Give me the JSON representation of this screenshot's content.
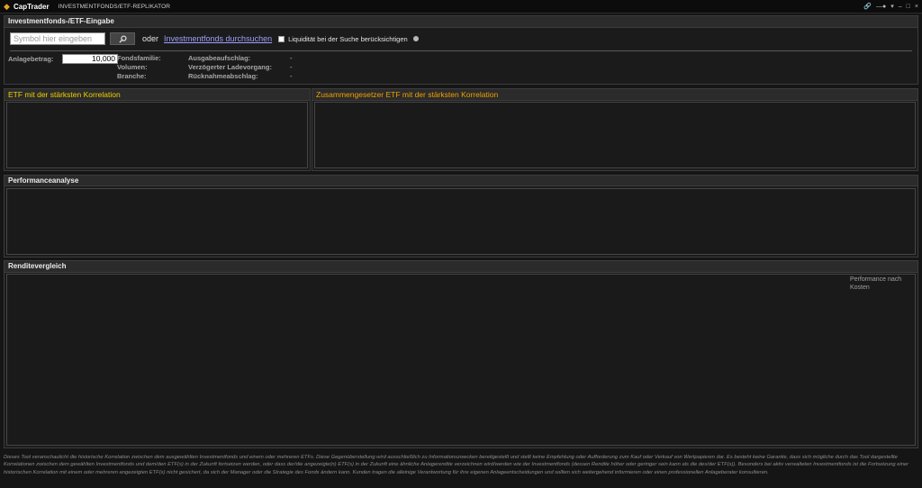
{
  "window": {
    "brand": "CapTrader",
    "title": "INVESTMENTFONDS/ETF-REPLIKATOR",
    "controls": [
      "link-icon",
      "pin-icon",
      "minimize-icon",
      "maximize-icon",
      "close-icon"
    ]
  },
  "input_section": {
    "title": "Investmentfonds-/ETF-Eingabe",
    "symbol_placeholder": "Symbol hier eingeben",
    "or_text": "oder",
    "search_link": "Investmentfonds durchsuchen",
    "liquidity_label": "Liquidität bei der Suche berücksichtigen",
    "liquidity_checked": false,
    "amount_label": "Anlagebetrag:",
    "amount_value": "10,000",
    "fund_family_label": "Fondsfamilie:",
    "volume_label": "Volumen:",
    "sector_label": "Branche:",
    "load_label": "Ausgabeaufschlag:",
    "load_value": "-",
    "delayed_label": "Verzögerter Ladevorgang:",
    "delayed_value": "-",
    "redemption_label": "Rücknahmeabschlag:",
    "redemption_value": "-"
  },
  "correlation": {
    "left_title": "ETF mit der stärksten Korrelation",
    "right_title": "Zusammengesetzer ETF mit der stärksten Korrelation",
    "left_color": "#f0d000",
    "right_color": "#f0a000"
  },
  "performance": {
    "title": "Performanceanalyse"
  },
  "returns": {
    "title": "Renditevergleich",
    "note": "Performance nach Kosten"
  },
  "disclaimer": "Dieses Tool veranschaulicht die historische Korrelation zwischen dem ausgewählten Investmentfonds und einem oder mehreren ETFs. Diese Gegenüberstellung wird ausschließlich zu Informationszwecken bereitgestellt und stellt keine Empfehlung oder Aufforderung zum Kauf oder Verkauf von Wertpapieren dar. Es besteht keine Garantie, dass sich mögliche durch das Tool dargestellte Korrelationen zwischen dem gewählten Investmentfonds und dem/den ETF(s) in der Zukunft fortsetzen werden, oder dass der/die angezeigte(n) ETF(s) in der Zukunft eine ähnliche Anlagerendite verzeichnen wird/werden wie der Investmentfonds (dessen Rendite höher oder geringer sein kann als die des/der ETF(s)). Besonders bei aktiv verwalteten Investmentfonds ist die Fortsetzung einer historischen Korrelation mit einem oder mehreren angezeigten ETF(s) nicht gesichert, da sich der Manager oder die Strategie des Fonds ändern kann. Kunden tragen die alleinige Verantwortung für ihre eigenen Anlageentscheidungen und sollten sich weitergehend informieren oder einen professionellen Anlageberater konsultieren."
}
